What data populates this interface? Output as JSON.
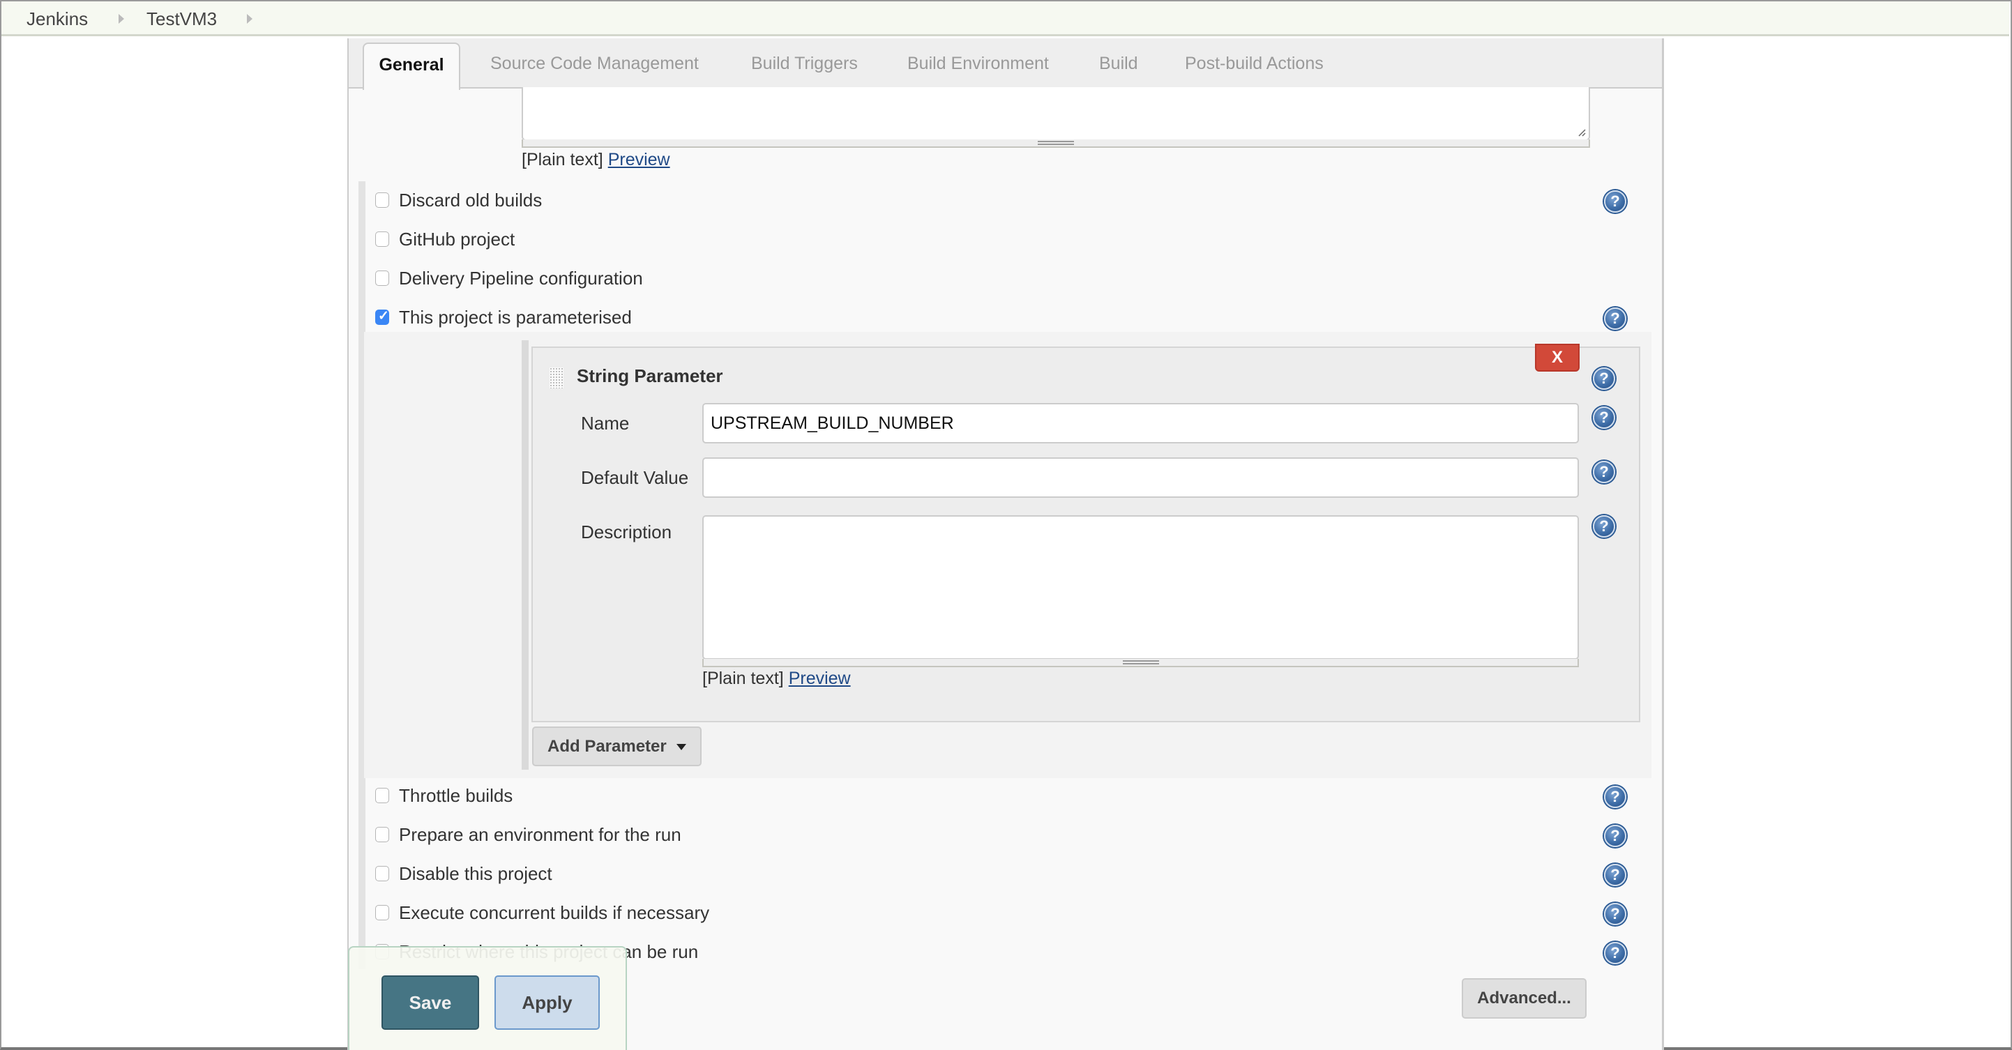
{
  "breadcrumb": {
    "items": [
      "Jenkins",
      "TestVM3"
    ]
  },
  "tabs": [
    {
      "label": "General",
      "active": true
    },
    {
      "label": "Source Code Management",
      "active": false
    },
    {
      "label": "Build Triggers",
      "active": false
    },
    {
      "label": "Build Environment",
      "active": false
    },
    {
      "label": "Build",
      "active": false
    },
    {
      "label": "Post-build Actions",
      "active": false
    }
  ],
  "project_description": {
    "value": "",
    "plain_text_label": "[Plain text]",
    "preview_link": "Preview"
  },
  "options_top": [
    {
      "label": "Discard old builds",
      "checked": false,
      "help": true
    },
    {
      "label": "GitHub project",
      "checked": false,
      "help": false
    },
    {
      "label": "Delivery Pipeline configuration",
      "checked": false,
      "help": false
    },
    {
      "label": "This project is parameterised",
      "checked": true,
      "help": true
    }
  ],
  "string_parameter": {
    "title": "String Parameter",
    "delete_label": "X",
    "fields": {
      "name_label": "Name",
      "name_value": "UPSTREAM_BUILD_NUMBER",
      "default_label": "Default Value",
      "default_value": "",
      "description_label": "Description",
      "description_value": ""
    },
    "plain_text_label": "[Plain text]",
    "preview_link": "Preview"
  },
  "add_parameter_label": "Add Parameter",
  "options_bottom": [
    {
      "label": "Throttle builds",
      "checked": false
    },
    {
      "label": "Prepare an environment for the run",
      "checked": false
    },
    {
      "label": "Disable this project",
      "checked": false
    },
    {
      "label": "Execute concurrent builds if necessary",
      "checked": false
    },
    {
      "label": "Restrict where this project can be run",
      "checked": false
    }
  ],
  "buttons": {
    "save": "Save",
    "apply": "Apply",
    "advanced": "Advanced..."
  },
  "help_icon_glyph": "?",
  "colors": {
    "save_bg": "#467584",
    "apply_bg": "#cddcec",
    "delete_bg": "#d24939",
    "checkbox_checked": "#3a86f5",
    "link": "#204a87",
    "breadcrumb_bg": "#f6f9f1"
  }
}
